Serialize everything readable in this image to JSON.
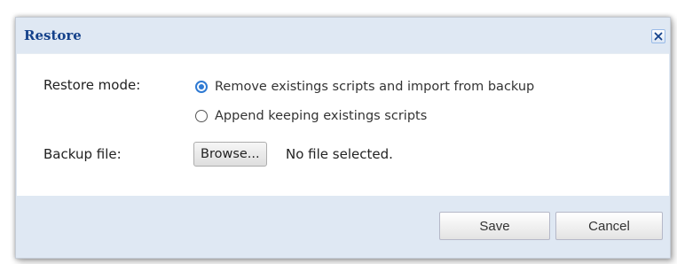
{
  "dialog": {
    "title": "Restore",
    "close_icon": "close-icon"
  },
  "form": {
    "restore_mode_label": "Restore mode:",
    "options": [
      {
        "label": "Remove existings scripts and import from backup",
        "checked": true
      },
      {
        "label": "Append keeping existings scripts",
        "checked": false
      }
    ],
    "backup_file_label": "Backup file:",
    "browse_label": "Browse...",
    "file_status": "No file selected."
  },
  "footer": {
    "save_label": "Save",
    "cancel_label": "Cancel"
  },
  "colors": {
    "title_text": "#15428b",
    "header_bg": "#dfe8f3",
    "radio_accent": "#2f7ad3"
  }
}
